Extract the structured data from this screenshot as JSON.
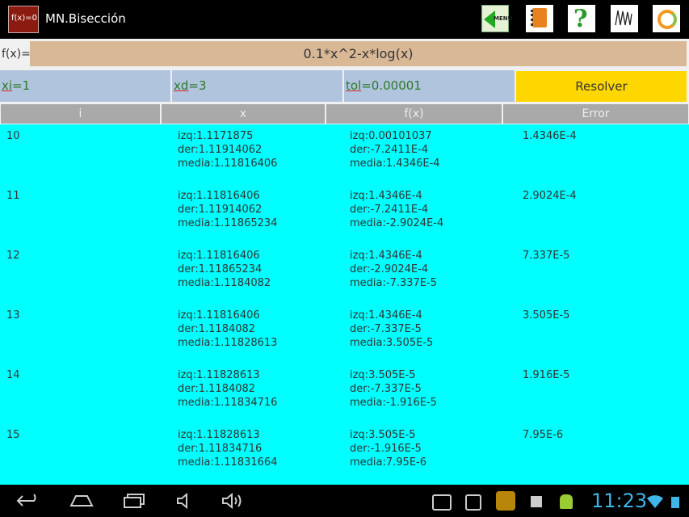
{
  "app": {
    "title": "MN.Bisección",
    "icon_text": "f(x)=0"
  },
  "toolbar": {
    "menu_label": "MENU",
    "icons": [
      "menu-icon",
      "notebook-icon",
      "help-icon",
      "graph-icon",
      "refresh-icon"
    ]
  },
  "function": {
    "label": "f(x)=",
    "value": "0.1*x^2-x*log(x)"
  },
  "params": {
    "xi": {
      "name": "xi",
      "value": "=1"
    },
    "xd": {
      "name": "xd",
      "value": "=3"
    },
    "tol": {
      "name": "tol",
      "value": "=0.00001"
    },
    "solve_label": "Resolver"
  },
  "table": {
    "headers": [
      "i",
      "x",
      "f(x)",
      "Error"
    ],
    "rows": [
      {
        "i": "10",
        "x": "izq:1.1171875\nder:1.11914062\nmedia:1.11816406",
        "fx": "izq:0.00101037\nder:-7.2411E-4\nmedia:1.4346E-4",
        "error": "1.4346E-4"
      },
      {
        "i": "11",
        "x": "izq:1.11816406\nder:1.11914062\nmedia:1.11865234",
        "fx": "izq:1.4346E-4\nder:-7.2411E-4\nmedia:-2.9024E-4",
        "error": "2.9024E-4"
      },
      {
        "i": "12",
        "x": "izq:1.11816406\nder:1.11865234\nmedia:1.1184082",
        "fx": "izq:1.4346E-4\nder:-2.9024E-4\nmedia:-7.337E-5",
        "error": "7.337E-5"
      },
      {
        "i": "13",
        "x": "izq:1.11816406\nder:1.1184082\nmedia:1.11828613",
        "fx": "izq:1.4346E-4\nder:-7.337E-5\nmedia:3.505E-5",
        "error": "3.505E-5"
      },
      {
        "i": "14",
        "x": "izq:1.11828613\nder:1.1184082\nmedia:1.11834716",
        "fx": "izq:3.505E-5\nder:-7.337E-5\nmedia:-1.916E-5",
        "error": "1.916E-5"
      },
      {
        "i": "15",
        "x": "izq:1.11828613\nder:1.11834716\nmedia:1.11831664",
        "fx": "izq:3.505E-5\nder:-1.916E-5\nmedia:7.95E-6",
        "error": "7.95E-6"
      }
    ]
  },
  "status_bar": {
    "time": "11:23"
  },
  "colors": {
    "function_bg": "#d9b896",
    "param_bg": "#b0c4de",
    "solve_bg": "#ffd700",
    "table_bg": "#00ffff",
    "header_bg": "#a9a9a9",
    "clock": "#3fb5e8"
  }
}
